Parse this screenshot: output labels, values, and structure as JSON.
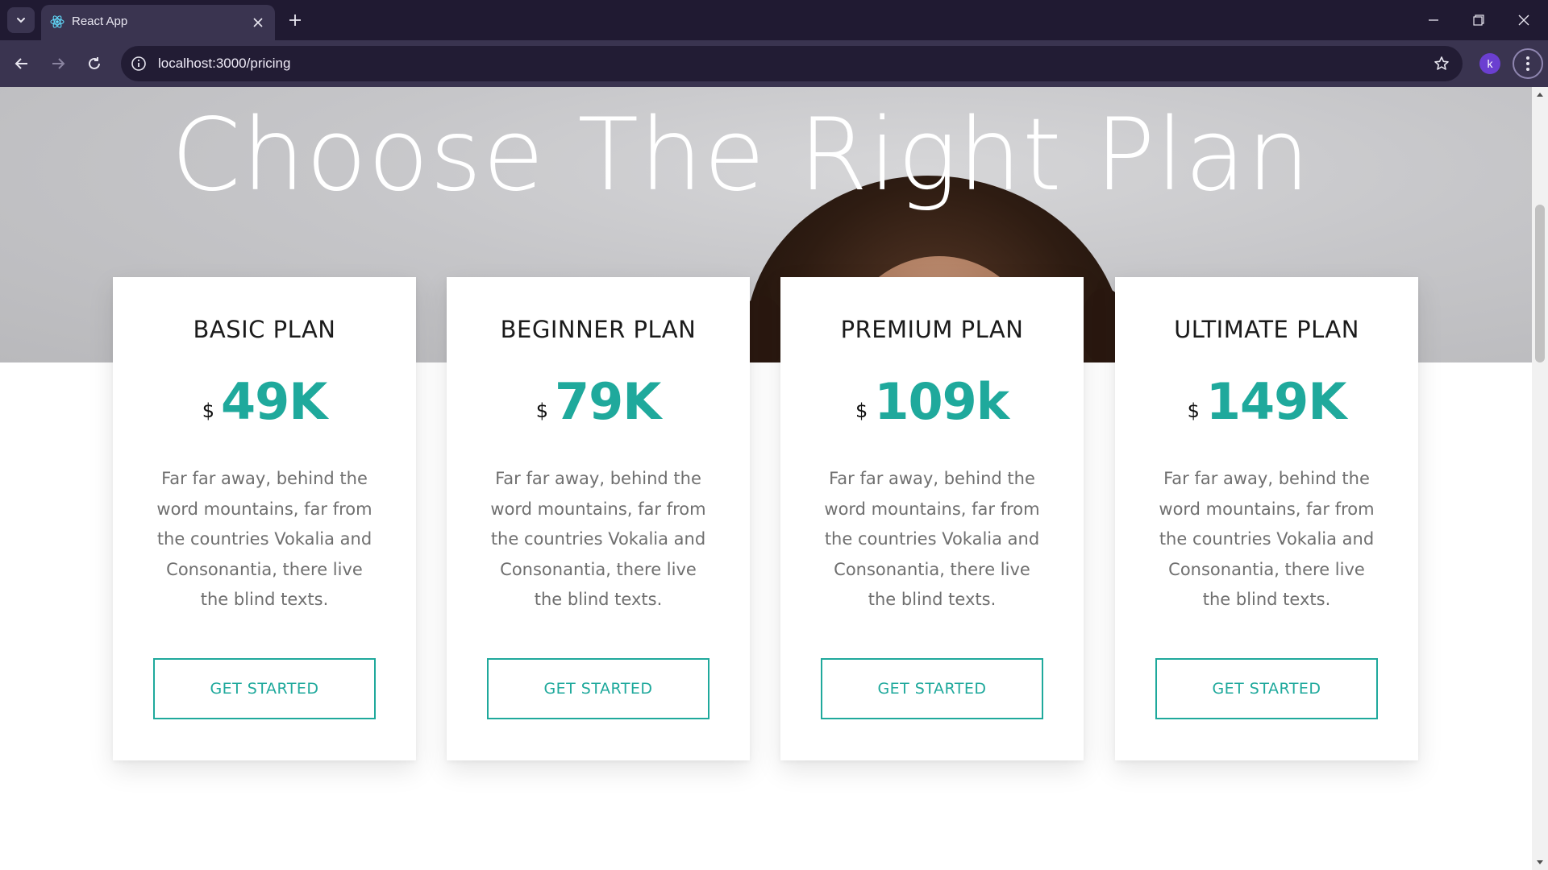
{
  "browser": {
    "tab_title": "React App",
    "url": "localhost:3000/pricing",
    "profile_initial": "k",
    "accent_color": "#6b3fd1"
  },
  "hero": {
    "title": "Choose The Right Plan"
  },
  "plans": [
    {
      "name": "BASIC PLAN",
      "currency": "$",
      "amount": "49K",
      "description": "Far far away, behind the word mountains, far from the countries Vokalia and Consonantia, there live the blind texts.",
      "cta": "GET STARTED"
    },
    {
      "name": "BEGINNER PLAN",
      "currency": "$",
      "amount": "79K",
      "description": "Far far away, behind the word mountains, far from the countries Vokalia and Consonantia, there live the blind texts.",
      "cta": "GET STARTED"
    },
    {
      "name": "PREMIUM PLAN",
      "currency": "$",
      "amount": "109k",
      "description": "Far far away, behind the word mountains, far from the countries Vokalia and Consonantia, there live the blind texts.",
      "cta": "GET STARTED"
    },
    {
      "name": "ULTIMATE PLAN",
      "currency": "$",
      "amount": "149K",
      "description": "Far far away, behind the word mountains, far from the countries Vokalia and Consonantia, there live the blind texts.",
      "cta": "GET STARTED"
    }
  ],
  "theme": {
    "accent": "#1fa99c",
    "chrome_bg": "#201a32",
    "toolbar_bg": "#3a3450"
  },
  "icons": {
    "tab_search": "chevron-down-icon",
    "favicon": "react-icon",
    "close": "close-icon",
    "new_tab": "plus-icon",
    "minimize": "minimize-icon",
    "restore": "restore-icon",
    "window_close": "close-icon",
    "back": "arrow-left-icon",
    "forward": "arrow-right-icon",
    "reload": "reload-icon",
    "site_info": "info-icon",
    "bookmark": "star-icon",
    "menu": "kebab-menu-icon"
  }
}
